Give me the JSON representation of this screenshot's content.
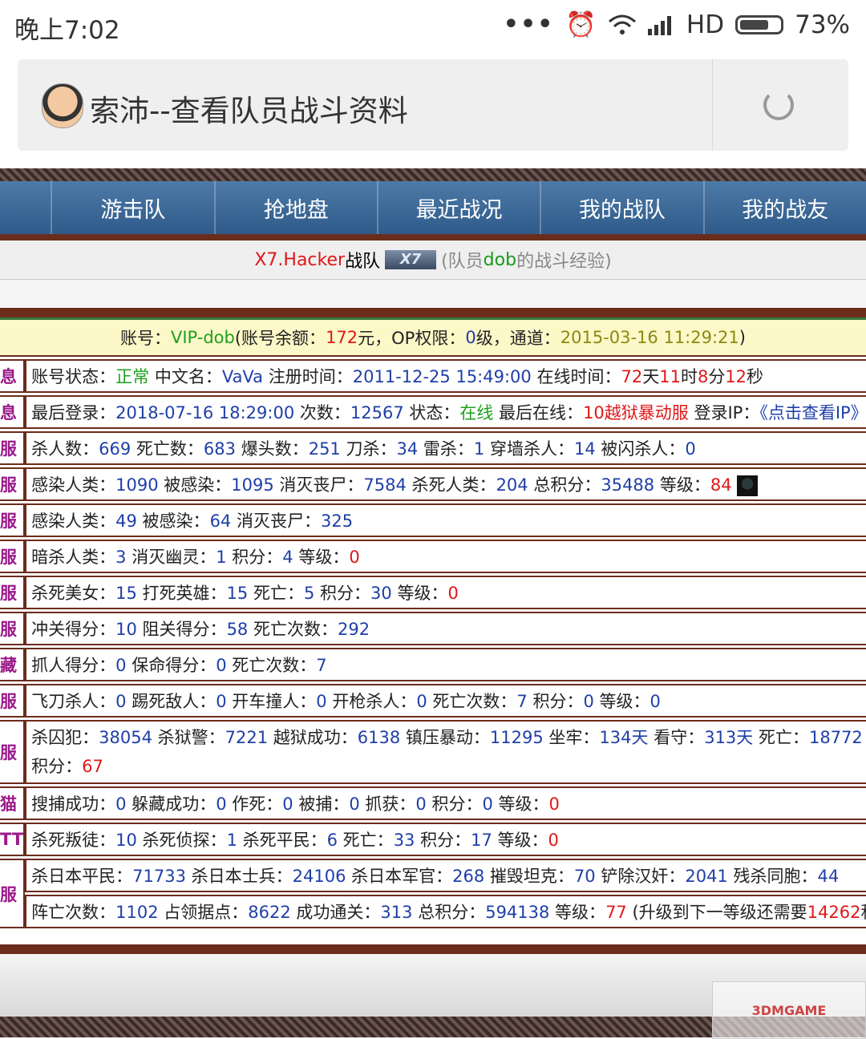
{
  "status": {
    "time": "晚上7:02",
    "network": "HD",
    "battery": "73%",
    "battery_level": 0.73,
    "icons": [
      "more-dots-icon",
      "alarm-icon",
      "wifi-icon",
      "signal-icon",
      "battery-icon"
    ]
  },
  "browser": {
    "title": "索沛--查看队员战斗资料"
  },
  "nav": {
    "items": [
      "游击队",
      "抢地盘",
      "最近战况",
      "我的战队",
      "我的战友"
    ]
  },
  "team": {
    "name": "X7.Hacker",
    "suffix": "战队",
    "logo_text": "X7",
    "pre": "(队员",
    "member": "dob",
    "post": "的战斗经验)"
  },
  "account": {
    "l1": "账号：",
    "id": "VIP-dob",
    "l2": "(账号余额：",
    "balance": "172",
    "l3": "元，OP权限：",
    "op": "0",
    "l4": "级，通道：",
    "channel": "2015-03-16 11:29:21",
    "l5": ")"
  },
  "rows": [
    {
      "label": "息",
      "parts": [
        [
          "账号状态：",
          ""
        ],
        [
          "正常",
          "grn"
        ],
        [
          " 中文名：",
          ""
        ],
        [
          "VaVa",
          "blue"
        ],
        [
          " 注册时间：",
          ""
        ],
        [
          "2011-12-25 15:49:00",
          "blue"
        ],
        [
          " 在线时间：",
          ""
        ],
        [
          "72",
          "red"
        ],
        [
          "天",
          ""
        ],
        [
          "11",
          "red"
        ],
        [
          "时",
          ""
        ],
        [
          "8",
          "red"
        ],
        [
          "分",
          ""
        ],
        [
          "12",
          "red"
        ],
        [
          "秒",
          ""
        ]
      ]
    },
    {
      "label": "息",
      "parts": [
        [
          "最后登录：",
          ""
        ],
        [
          "2018-07-16 18:29:00",
          "blue"
        ],
        [
          " 次数：",
          ""
        ],
        [
          "12567",
          "blue"
        ],
        [
          " 状态：",
          ""
        ],
        [
          "在线",
          "grn"
        ],
        [
          " 最后在线：",
          ""
        ],
        [
          "10越狱暴动服",
          "red"
        ],
        [
          " 登录IP：",
          ""
        ],
        [
          "《点击查看IP》",
          "blue"
        ]
      ]
    },
    {
      "label": "服",
      "parts": [
        [
          "杀人数：",
          ""
        ],
        [
          "669",
          "blue"
        ],
        [
          " 死亡数：",
          ""
        ],
        [
          "683",
          "blue"
        ],
        [
          " 爆头数：",
          ""
        ],
        [
          "251",
          "blue"
        ],
        [
          " 刀杀：",
          ""
        ],
        [
          "34",
          "blue"
        ],
        [
          " 雷杀：",
          ""
        ],
        [
          "1",
          "blue"
        ],
        [
          " 穿墙杀人：",
          ""
        ],
        [
          "14",
          "blue"
        ],
        [
          " 被闪杀人：",
          ""
        ],
        [
          "0",
          "blue"
        ]
      ]
    },
    {
      "label": "服",
      "avatar": true,
      "parts": [
        [
          "感染人类：",
          ""
        ],
        [
          "1090",
          "blue"
        ],
        [
          " 被感染：",
          ""
        ],
        [
          "1095",
          "blue"
        ],
        [
          " 消灭丧尸：",
          ""
        ],
        [
          "7584",
          "blue"
        ],
        [
          " 杀死人类：",
          ""
        ],
        [
          "204",
          "blue"
        ],
        [
          " 总积分：",
          ""
        ],
        [
          "35488",
          "blue"
        ],
        [
          " 等级：",
          ""
        ],
        [
          "84",
          "red"
        ]
      ]
    },
    {
      "label": "服",
      "parts": [
        [
          "感染人类：",
          ""
        ],
        [
          "49",
          "blue"
        ],
        [
          " 被感染：",
          ""
        ],
        [
          "64",
          "blue"
        ],
        [
          " 消灭丧尸：",
          ""
        ],
        [
          "325",
          "blue"
        ]
      ]
    },
    {
      "label": "服",
      "parts": [
        [
          "暗杀人类：",
          ""
        ],
        [
          "3",
          "blue"
        ],
        [
          " 消灭幽灵：",
          ""
        ],
        [
          "1",
          "blue"
        ],
        [
          " 积分：",
          ""
        ],
        [
          "4",
          "blue"
        ],
        [
          " 等级：",
          ""
        ],
        [
          "0",
          "red"
        ]
      ]
    },
    {
      "label": "服",
      "parts": [
        [
          "杀死美女：",
          ""
        ],
        [
          "15",
          "blue"
        ],
        [
          " 打死英雄：",
          ""
        ],
        [
          "15",
          "blue"
        ],
        [
          " 死亡：",
          ""
        ],
        [
          "5",
          "blue"
        ],
        [
          " 积分：",
          ""
        ],
        [
          "30",
          "blue"
        ],
        [
          " 等级：",
          ""
        ],
        [
          "0",
          "red"
        ]
      ]
    },
    {
      "label": "服",
      "parts": [
        [
          "冲关得分：",
          ""
        ],
        [
          "10",
          "blue"
        ],
        [
          " 阻关得分：",
          ""
        ],
        [
          "58",
          "blue"
        ],
        [
          " 死亡次数：",
          ""
        ],
        [
          "292",
          "blue"
        ]
      ]
    },
    {
      "label": "藏",
      "parts": [
        [
          "抓人得分：",
          ""
        ],
        [
          "0",
          "blue"
        ],
        [
          " 保命得分：",
          ""
        ],
        [
          "0",
          "blue"
        ],
        [
          " 死亡次数：",
          ""
        ],
        [
          "7",
          "blue"
        ]
      ]
    },
    {
      "label": "服",
      "parts": [
        [
          "飞刀杀人：",
          ""
        ],
        [
          "0",
          "blue"
        ],
        [
          " 踢死敌人：",
          ""
        ],
        [
          "0",
          "blue"
        ],
        [
          " 开车撞人：",
          ""
        ],
        [
          "0",
          "blue"
        ],
        [
          " 开枪杀人：",
          ""
        ],
        [
          "0",
          "blue"
        ],
        [
          " 死亡次数：",
          ""
        ],
        [
          "7",
          "blue"
        ],
        [
          " 积分：",
          ""
        ],
        [
          "0",
          "blue"
        ],
        [
          " 等级：",
          ""
        ],
        [
          "0",
          "blue"
        ]
      ]
    },
    {
      "label": "服",
      "tall": true,
      "parts": [
        [
          "杀囚犯：",
          ""
        ],
        [
          "38054",
          "blue"
        ],
        [
          " 杀狱警：",
          ""
        ],
        [
          "7221",
          "blue"
        ],
        [
          " 越狱成功：",
          ""
        ],
        [
          "6138",
          "blue"
        ],
        [
          " 镇压暴动：",
          ""
        ],
        [
          "11295",
          "blue"
        ],
        [
          " 坐牢：",
          ""
        ],
        [
          "134天",
          "blue"
        ],
        [
          " 看守：",
          ""
        ],
        [
          "313天",
          "blue"
        ],
        [
          " 死亡：",
          ""
        ],
        [
          "18772",
          "blue"
        ],
        [
          " 积分：",
          ""
        ],
        [
          "67",
          "red"
        ]
      ]
    },
    {
      "label": "猫",
      "parts": [
        [
          "搜捕成功：",
          ""
        ],
        [
          "0",
          "blue"
        ],
        [
          " 躲藏成功：",
          ""
        ],
        [
          "0",
          "blue"
        ],
        [
          " 作死：",
          ""
        ],
        [
          "0",
          "blue"
        ],
        [
          " 被捕：",
          ""
        ],
        [
          "0",
          "blue"
        ],
        [
          " 抓获：",
          ""
        ],
        [
          "0",
          "blue"
        ],
        [
          " 积分：",
          ""
        ],
        [
          "0",
          "blue"
        ],
        [
          " 等级：",
          ""
        ],
        [
          "0",
          "red"
        ]
      ]
    },
    {
      "label": "TT",
      "parts": [
        [
          "杀死叛徒：",
          ""
        ],
        [
          "10",
          "blue"
        ],
        [
          " 杀死侦探：",
          ""
        ],
        [
          "1",
          "blue"
        ],
        [
          " 杀死平民：",
          ""
        ],
        [
          "6",
          "blue"
        ],
        [
          " 死亡：",
          ""
        ],
        [
          "33",
          "blue"
        ],
        [
          " 积分：",
          ""
        ],
        [
          "17",
          "blue"
        ],
        [
          " 等级：",
          ""
        ],
        [
          "0",
          "red"
        ]
      ]
    },
    {
      "label": "服",
      "span": 2,
      "parts": [
        [
          "杀日本平民：",
          ""
        ],
        [
          "71733",
          "blue"
        ],
        [
          " 杀日本士兵：",
          ""
        ],
        [
          "24106",
          "blue"
        ],
        [
          " 杀日本军官：",
          ""
        ],
        [
          "268",
          "blue"
        ],
        [
          " 摧毁坦克：",
          ""
        ],
        [
          "70",
          "blue"
        ],
        [
          " 铲除汉奸：",
          ""
        ],
        [
          "2041",
          "blue"
        ],
        [
          " 残杀同胞：",
          ""
        ],
        [
          "44",
          "blue"
        ]
      ]
    },
    {
      "label": "",
      "cont": true,
      "parts": [
        [
          "阵亡次数：",
          ""
        ],
        [
          "1102",
          "blue"
        ],
        [
          " 占领据点：",
          ""
        ],
        [
          "8622",
          "blue"
        ],
        [
          " 成功通关：",
          ""
        ],
        [
          "313",
          "blue"
        ],
        [
          " 总积分：",
          ""
        ],
        [
          "594138",
          "blue"
        ],
        [
          " 等级：",
          ""
        ],
        [
          "77",
          "red"
        ],
        [
          " (升级到下一等级还需要",
          ""
        ],
        [
          "14262",
          "red"
        ],
        [
          "积",
          ""
        ]
      ]
    }
  ],
  "watermark": "3DMGAME"
}
